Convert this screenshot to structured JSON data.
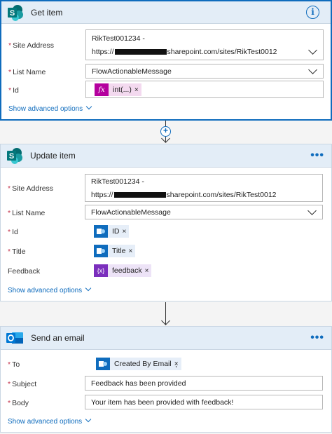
{
  "get_item": {
    "title": "Get item",
    "info_glyph": "i",
    "fields": {
      "site_address": {
        "label": "Site Address",
        "line1": "RikTest001234 -",
        "line2_prefix": "https://",
        "line2_suffix": "sharepoint.com/sites/RikTest0012"
      },
      "list_name": {
        "label": "List Name",
        "value": "FlowActionableMessage"
      },
      "id": {
        "label": "Id",
        "token": "int(...)",
        "token_icon": "fx"
      }
    },
    "advanced": "Show advanced options"
  },
  "update_item": {
    "title": "Update item",
    "more": "•••",
    "fields": {
      "site_address": {
        "label": "Site Address",
        "line1": "RikTest001234 -",
        "line2_prefix": "https://",
        "line2_suffix": "sharepoint.com/sites/RikTest0012"
      },
      "list_name": {
        "label": "List Name",
        "value": "FlowActionableMessage"
      },
      "id": {
        "label": "Id",
        "token": "ID"
      },
      "title": {
        "label": "Title",
        "token": "Title"
      },
      "feedback": {
        "label": "Feedback",
        "token": "feedback",
        "token_icon": "{x}"
      }
    },
    "advanced": "Show advanced options"
  },
  "send_email": {
    "title": "Send an email",
    "more": "•••",
    "fields": {
      "to": {
        "label": "To",
        "token": "Created By Email",
        "suffix": ";"
      },
      "subject": {
        "label": "Subject",
        "value": "Feedback has been provided"
      },
      "body": {
        "label": "Body",
        "value": "Your item has been provided with feedback!"
      }
    },
    "advanced": "Show advanced options"
  },
  "common": {
    "required_mark": "*",
    "remove_glyph": "×",
    "plus_glyph": "+"
  },
  "colors": {
    "accent": "#0f6cbd",
    "required": "#c4314b",
    "header_bg": "#e3edf7",
    "fx": "#b4009e",
    "variable": "#7b2fbd"
  }
}
